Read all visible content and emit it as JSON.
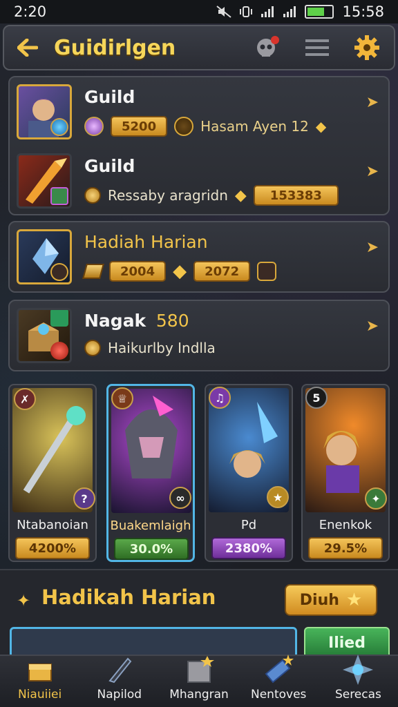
{
  "status_bar": {
    "time": "2:20",
    "clock": "15:58"
  },
  "header": {
    "title": "Guidirlgen"
  },
  "guild_card": {
    "rows": [
      {
        "title": "Guild",
        "pill": "5200",
        "extra": "Hasam Ayen 12"
      },
      {
        "title": "Guild",
        "sub": "Ressaby aragridn",
        "pill": "153383"
      }
    ]
  },
  "daily_card": {
    "title": "Hadiah Harian",
    "pill1": "2004",
    "pill2": "2072"
  },
  "nagak_card": {
    "title": "Nagak",
    "value": "580",
    "sub": "Haikurlby Indlla"
  },
  "heroes": [
    {
      "name": "Ntabanoian",
      "value": "4200%",
      "badge": "",
      "color": "#d9a83b"
    },
    {
      "name": "Buakemlaigh",
      "value": "30.0%",
      "badge": "",
      "color": "#4f8f3a"
    },
    {
      "name": "Pd",
      "value": "2380%",
      "badge": "",
      "color": "#8e4fb0"
    },
    {
      "name": "Enenkok",
      "value": "29.5%",
      "badge": "5",
      "color": "#d9a83b"
    }
  ],
  "daily_section": {
    "title": "Hadikah Harian",
    "button": "Diuh",
    "green_button": "Ilied"
  },
  "nav": [
    {
      "label": "Niauiiei"
    },
    {
      "label": "Napilod"
    },
    {
      "label": "Mhangran"
    },
    {
      "label": "Nentoves"
    },
    {
      "label": "Serecas"
    }
  ],
  "colors": {
    "gold": "#f2c44a",
    "accent_blue": "#52b6e6"
  }
}
